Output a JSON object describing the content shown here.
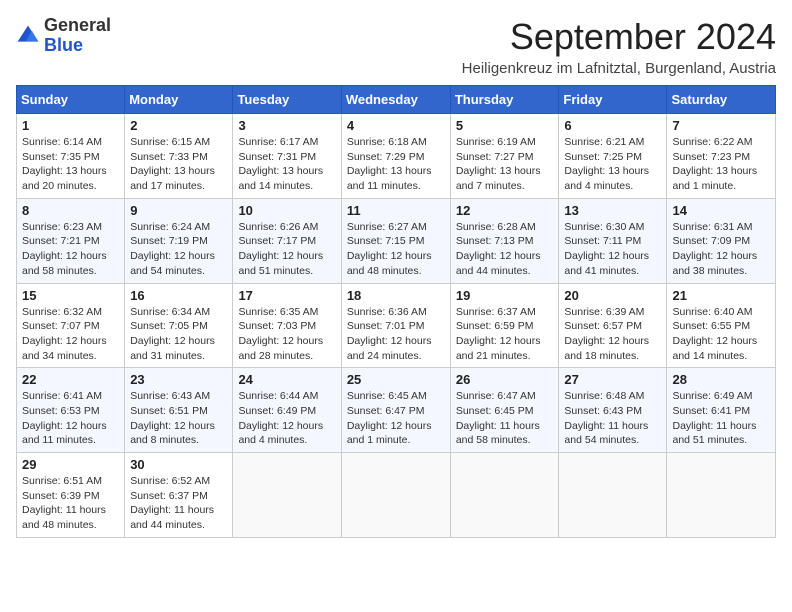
{
  "logo": {
    "general": "General",
    "blue": "Blue"
  },
  "title": "September 2024",
  "subtitle": "Heiligenkreuz im Lafnitztal, Burgenland, Austria",
  "days_of_week": [
    "Sunday",
    "Monday",
    "Tuesday",
    "Wednesday",
    "Thursday",
    "Friday",
    "Saturday"
  ],
  "weeks": [
    [
      {
        "day": "1",
        "sunrise": "6:14 AM",
        "sunset": "7:35 PM",
        "daylight": "13 hours and 20 minutes."
      },
      {
        "day": "2",
        "sunrise": "6:15 AM",
        "sunset": "7:33 PM",
        "daylight": "13 hours and 17 minutes."
      },
      {
        "day": "3",
        "sunrise": "6:17 AM",
        "sunset": "7:31 PM",
        "daylight": "13 hours and 14 minutes."
      },
      {
        "day": "4",
        "sunrise": "6:18 AM",
        "sunset": "7:29 PM",
        "daylight": "13 hours and 11 minutes."
      },
      {
        "day": "5",
        "sunrise": "6:19 AM",
        "sunset": "7:27 PM",
        "daylight": "13 hours and 7 minutes."
      },
      {
        "day": "6",
        "sunrise": "6:21 AM",
        "sunset": "7:25 PM",
        "daylight": "13 hours and 4 minutes."
      },
      {
        "day": "7",
        "sunrise": "6:22 AM",
        "sunset": "7:23 PM",
        "daylight": "13 hours and 1 minute."
      }
    ],
    [
      {
        "day": "8",
        "sunrise": "6:23 AM",
        "sunset": "7:21 PM",
        "daylight": "12 hours and 58 minutes."
      },
      {
        "day": "9",
        "sunrise": "6:24 AM",
        "sunset": "7:19 PM",
        "daylight": "12 hours and 54 minutes."
      },
      {
        "day": "10",
        "sunrise": "6:26 AM",
        "sunset": "7:17 PM",
        "daylight": "12 hours and 51 minutes."
      },
      {
        "day": "11",
        "sunrise": "6:27 AM",
        "sunset": "7:15 PM",
        "daylight": "12 hours and 48 minutes."
      },
      {
        "day": "12",
        "sunrise": "6:28 AM",
        "sunset": "7:13 PM",
        "daylight": "12 hours and 44 minutes."
      },
      {
        "day": "13",
        "sunrise": "6:30 AM",
        "sunset": "7:11 PM",
        "daylight": "12 hours and 41 minutes."
      },
      {
        "day": "14",
        "sunrise": "6:31 AM",
        "sunset": "7:09 PM",
        "daylight": "12 hours and 38 minutes."
      }
    ],
    [
      {
        "day": "15",
        "sunrise": "6:32 AM",
        "sunset": "7:07 PM",
        "daylight": "12 hours and 34 minutes."
      },
      {
        "day": "16",
        "sunrise": "6:34 AM",
        "sunset": "7:05 PM",
        "daylight": "12 hours and 31 minutes."
      },
      {
        "day": "17",
        "sunrise": "6:35 AM",
        "sunset": "7:03 PM",
        "daylight": "12 hours and 28 minutes."
      },
      {
        "day": "18",
        "sunrise": "6:36 AM",
        "sunset": "7:01 PM",
        "daylight": "12 hours and 24 minutes."
      },
      {
        "day": "19",
        "sunrise": "6:37 AM",
        "sunset": "6:59 PM",
        "daylight": "12 hours and 21 minutes."
      },
      {
        "day": "20",
        "sunrise": "6:39 AM",
        "sunset": "6:57 PM",
        "daylight": "12 hours and 18 minutes."
      },
      {
        "day": "21",
        "sunrise": "6:40 AM",
        "sunset": "6:55 PM",
        "daylight": "12 hours and 14 minutes."
      }
    ],
    [
      {
        "day": "22",
        "sunrise": "6:41 AM",
        "sunset": "6:53 PM",
        "daylight": "12 hours and 11 minutes."
      },
      {
        "day": "23",
        "sunrise": "6:43 AM",
        "sunset": "6:51 PM",
        "daylight": "12 hours and 8 minutes."
      },
      {
        "day": "24",
        "sunrise": "6:44 AM",
        "sunset": "6:49 PM",
        "daylight": "12 hours and 4 minutes."
      },
      {
        "day": "25",
        "sunrise": "6:45 AM",
        "sunset": "6:47 PM",
        "daylight": "12 hours and 1 minute."
      },
      {
        "day": "26",
        "sunrise": "6:47 AM",
        "sunset": "6:45 PM",
        "daylight": "11 hours and 58 minutes."
      },
      {
        "day": "27",
        "sunrise": "6:48 AM",
        "sunset": "6:43 PM",
        "daylight": "11 hours and 54 minutes."
      },
      {
        "day": "28",
        "sunrise": "6:49 AM",
        "sunset": "6:41 PM",
        "daylight": "11 hours and 51 minutes."
      }
    ],
    [
      {
        "day": "29",
        "sunrise": "6:51 AM",
        "sunset": "6:39 PM",
        "daylight": "11 hours and 48 minutes."
      },
      {
        "day": "30",
        "sunrise": "6:52 AM",
        "sunset": "6:37 PM",
        "daylight": "11 hours and 44 minutes."
      },
      null,
      null,
      null,
      null,
      null
    ]
  ]
}
